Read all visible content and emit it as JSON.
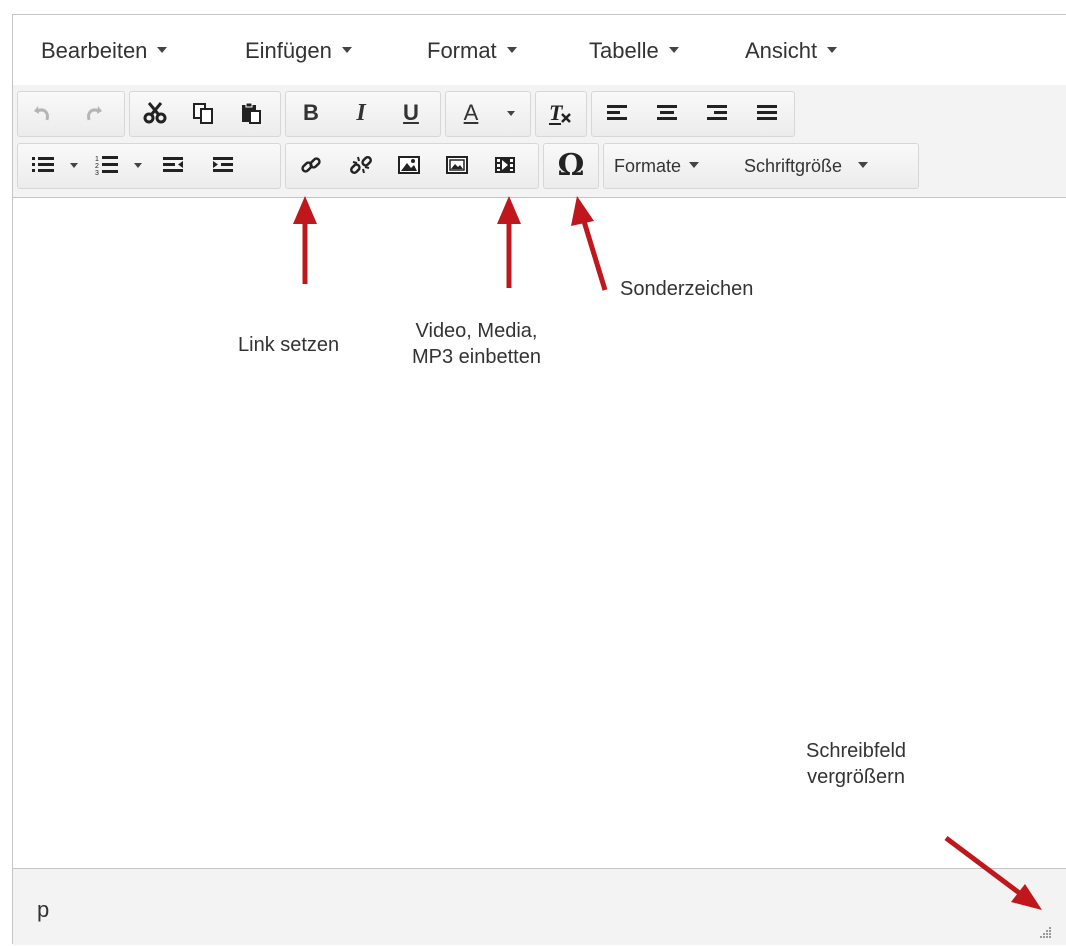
{
  "menubar": {
    "items": [
      {
        "label": "Bearbeiten"
      },
      {
        "label": "Einfügen"
      },
      {
        "label": "Format"
      },
      {
        "label": "Tabelle"
      },
      {
        "label": "Ansicht"
      }
    ]
  },
  "toolbar": {
    "row1": [
      {
        "icon": "undo-icon",
        "enabled": false
      },
      {
        "icon": "redo-icon",
        "enabled": false
      },
      {
        "icon": "cut-icon"
      },
      {
        "icon": "copy-icon"
      },
      {
        "icon": "paste-icon"
      },
      {
        "icon": "bold-icon",
        "glyph": "B"
      },
      {
        "icon": "italic-icon",
        "glyph": "I"
      },
      {
        "icon": "underline-icon",
        "glyph": "U"
      },
      {
        "icon": "text-color-icon",
        "glyph": "A"
      },
      {
        "icon": "remove-format-icon"
      },
      {
        "icon": "align-left-icon"
      },
      {
        "icon": "align-center-icon"
      },
      {
        "icon": "align-right-icon"
      },
      {
        "icon": "align-justify-icon"
      }
    ],
    "row2": [
      {
        "icon": "bullet-list-icon"
      },
      {
        "icon": "numbered-list-icon"
      },
      {
        "icon": "outdent-icon"
      },
      {
        "icon": "indent-icon"
      },
      {
        "icon": "link-icon"
      },
      {
        "icon": "unlink-icon"
      },
      {
        "icon": "image-icon"
      },
      {
        "icon": "image-gallery-icon"
      },
      {
        "icon": "media-icon"
      },
      {
        "icon": "special-char-icon",
        "glyph": "Ω"
      }
    ],
    "formats_label": "Formate",
    "fontsize_label": "Schriftgröße"
  },
  "annotations": {
    "link": "Link setzen",
    "media_line1": "Video, Media,",
    "media_line2": "MP3 einbetten",
    "special": "Sonderzeichen",
    "resize_line1": "Schreibfeld",
    "resize_line2": "vergrößern"
  },
  "statusbar": {
    "path": "p"
  },
  "colors": {
    "arrow": "#c0171c",
    "toolbar_bg": "#f3f3f3",
    "border": "#c5c5c5"
  }
}
